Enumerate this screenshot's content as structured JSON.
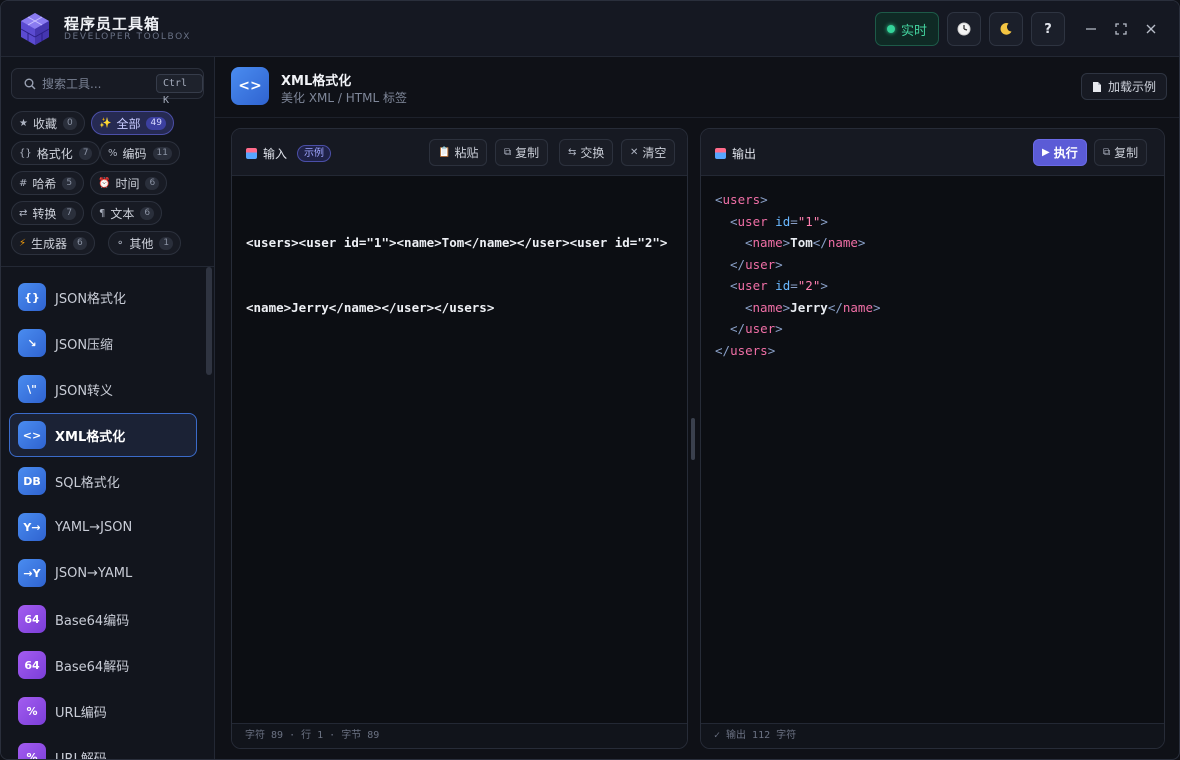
{
  "app": {
    "title": "程序员工具箱",
    "subtitle": "DEVELOPER TOOLBOX"
  },
  "titlebar": {
    "live_label": "实时",
    "help_label": "?",
    "history_icon": "clock-icon",
    "theme_icon": "moon-icon"
  },
  "search": {
    "placeholder": "搜索工具...",
    "shortcut": "Ctrl K"
  },
  "categories": [
    {
      "icon": "★",
      "label": "收藏",
      "count": "0"
    },
    {
      "icon": "✨",
      "label": "全部",
      "count": "49"
    },
    {
      "icon": "{}",
      "label": "格式化",
      "count": "7"
    },
    {
      "icon": "%",
      "label": "编码",
      "count": "11"
    },
    {
      "icon": "#",
      "label": "哈希",
      "count": "5"
    },
    {
      "icon": "⏰",
      "label": "时间",
      "count": "6"
    },
    {
      "icon": "⇄",
      "label": "转换",
      "count": "7"
    },
    {
      "icon": "¶",
      "label": "文本",
      "count": "6"
    },
    {
      "icon": "⚡",
      "label": "生成器",
      "count": "6"
    },
    {
      "icon": "⚬",
      "label": "其他",
      "count": "1"
    }
  ],
  "tools": [
    {
      "icon": "{}",
      "label": "JSON格式化"
    },
    {
      "icon": "↘",
      "label": "JSON压缩"
    },
    {
      "icon": "\\\"",
      "label": "JSON转义"
    },
    {
      "icon": "<>",
      "label": "XML格式化"
    },
    {
      "icon": "DB",
      "label": "SQL格式化"
    },
    {
      "icon": "Y→",
      "label": "YAML→JSON"
    },
    {
      "icon": "→Y",
      "label": "JSON→YAML"
    },
    {
      "icon": "64",
      "label": "Base64编码"
    },
    {
      "icon": "64",
      "label": "Base64解码"
    },
    {
      "icon": "%",
      "label": "URL编码"
    },
    {
      "icon": "%",
      "label": "URL解码"
    }
  ],
  "page": {
    "icon": "<>",
    "title": "XML格式化",
    "subtitle": "美化 XML / HTML 标签",
    "load_sample": "加载示例"
  },
  "input_panel": {
    "title": "输入",
    "tag": "示例",
    "paste": "粘贴",
    "copy": "复制",
    "swap": "交换",
    "clear": "清空",
    "lines": [
      "<users><user id=\"1\"><name>Tom</name></user><user id=\"2\">",
      "<name>Jerry</name></user></users>"
    ],
    "footer": "字符 89 · 行 1 · 字节 89"
  },
  "output_panel": {
    "title": "输出",
    "run": "执行",
    "copy": "复制",
    "footer": "✓ 输出 112 字符",
    "lines": [
      {
        "indent": 0,
        "tokens": [
          [
            "brk",
            "<"
          ],
          [
            "tag",
            "users"
          ],
          [
            "brk",
            ">"
          ]
        ]
      },
      {
        "indent": 1,
        "tokens": [
          [
            "brk",
            "<"
          ],
          [
            "tag",
            "user"
          ],
          [
            "plain",
            " "
          ],
          [
            "attr",
            "id"
          ],
          [
            "brk",
            "="
          ],
          [
            "val",
            "\"1\""
          ],
          [
            "brk",
            ">"
          ]
        ]
      },
      {
        "indent": 2,
        "tokens": [
          [
            "brk",
            "<"
          ],
          [
            "tag",
            "name"
          ],
          [
            "brk",
            ">"
          ],
          [
            "txt",
            "Tom"
          ],
          [
            "brk",
            "</"
          ],
          [
            "tag",
            "name"
          ],
          [
            "brk",
            ">"
          ]
        ]
      },
      {
        "indent": 1,
        "tokens": [
          [
            "brk",
            "</"
          ],
          [
            "tag",
            "user"
          ],
          [
            "brk",
            ">"
          ]
        ]
      },
      {
        "indent": 1,
        "tokens": [
          [
            "brk",
            "<"
          ],
          [
            "tag",
            "user"
          ],
          [
            "plain",
            " "
          ],
          [
            "attr",
            "id"
          ],
          [
            "brk",
            "="
          ],
          [
            "val",
            "\"2\""
          ],
          [
            "brk",
            ">"
          ]
        ]
      },
      {
        "indent": 2,
        "tokens": [
          [
            "brk",
            "<"
          ],
          [
            "tag",
            "name"
          ],
          [
            "brk",
            ">"
          ],
          [
            "txt",
            "Jerry"
          ],
          [
            "brk",
            "</"
          ],
          [
            "tag",
            "name"
          ],
          [
            "brk",
            ">"
          ]
        ]
      },
      {
        "indent": 1,
        "tokens": [
          [
            "brk",
            "</"
          ],
          [
            "tag",
            "user"
          ],
          [
            "brk",
            ">"
          ]
        ]
      },
      {
        "indent": 0,
        "tokens": [
          [
            "brk",
            "</"
          ],
          [
            "tag",
            "users"
          ],
          [
            "brk",
            ">"
          ]
        ]
      }
    ]
  },
  "colors": {
    "accent": "#5b5bd6",
    "live": "#34d399",
    "tag": "#f06fa6",
    "attr": "#6ab8ff"
  }
}
